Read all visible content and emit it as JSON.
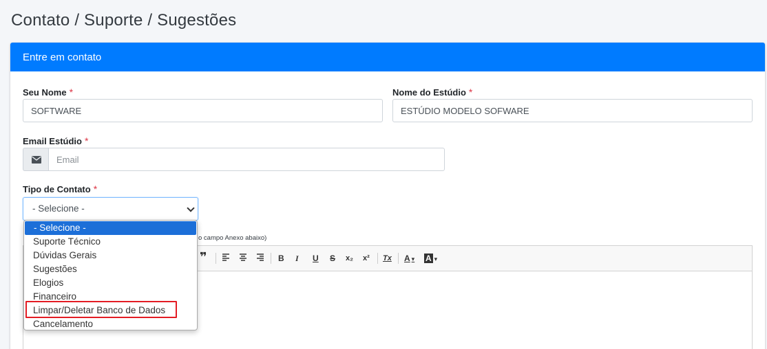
{
  "page": {
    "title": "Contato / Suporte / Sugestões"
  },
  "card": {
    "header": "Entre em contato"
  },
  "form": {
    "name": {
      "label": "Seu Nome",
      "required": "*",
      "value": "SOFTWARE"
    },
    "studio": {
      "label": "Nome do Estúdio",
      "required": "*",
      "value": "ESTÚDIO MODELO SOFWARE"
    },
    "email": {
      "label": "Email Estúdio",
      "required": "*",
      "placeholder": "Email",
      "icon": "envelope-icon"
    },
    "contact_type": {
      "label": "Tipo de Contato",
      "required": "*",
      "selected": "- Selecione -",
      "options": [
        "- Selecione -",
        "Suporte Técnico",
        "Dúvidas Gerais",
        "Sugestões",
        "Elogios",
        "Financeiro",
        "Limpar/Deletar Banco de Dados",
        "Cancelamento"
      ],
      "highlighted_option": "Limpar/Deletar Banco de Dados"
    },
    "hint_fragment": "o campo Anexo abaixo)"
  },
  "editor": {
    "toolbar": {
      "blockquote": "❞",
      "bold": "B",
      "italic": "I",
      "underline": "U",
      "strike": "S",
      "subscript": "x₂",
      "superscript": "x²",
      "clear_format": "Tx",
      "font_color": "A",
      "background_color": "A"
    }
  },
  "colors": {
    "primary": "#007bff",
    "required": "#dc3545",
    "highlight": "#e31b23",
    "selected_option": "#1c6fd8"
  }
}
